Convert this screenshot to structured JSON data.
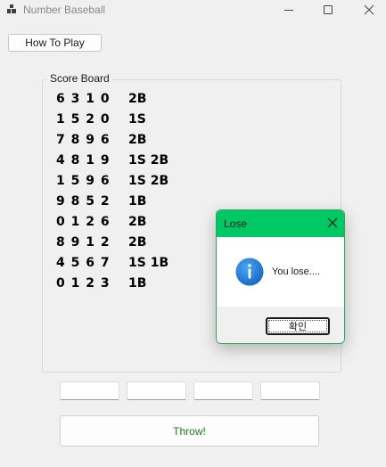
{
  "window": {
    "title": "Number Baseball",
    "icon": "app-icon",
    "controls": {
      "minimize_icon": "minimize-icon",
      "maximize_icon": "maximize-icon",
      "close_icon": "close-icon"
    }
  },
  "how_to_play_label": "How To Play",
  "scoreboard": {
    "title": "Score Board",
    "rows": [
      {
        "guess": "6 3 1 0",
        "result": "2B"
      },
      {
        "guess": "1 5 2 0",
        "result": "1S"
      },
      {
        "guess": "7 8 9 6",
        "result": "2B"
      },
      {
        "guess": "4 8 1 9",
        "result": "1S 2B"
      },
      {
        "guess": "1 5 9 6",
        "result": "1S 2B"
      },
      {
        "guess": "9 8 5 2",
        "result": "1B"
      },
      {
        "guess": "0 1 2 6",
        "result": "2B"
      },
      {
        "guess": "8 9 1 2",
        "result": "2B"
      },
      {
        "guess": "4 5 6 7",
        "result": "1S 1B"
      },
      {
        "guess": "0 1 2 3",
        "result": "1B"
      }
    ]
  },
  "inputs": [
    {
      "value": ""
    },
    {
      "value": ""
    },
    {
      "value": ""
    },
    {
      "value": ""
    }
  ],
  "throw_label": "Throw!",
  "dialog": {
    "title": "Lose",
    "message": "You lose....",
    "ok_label": "확인",
    "icon": "info-icon"
  },
  "colors": {
    "dialog_titlebar": "#00c864",
    "throw_text": "#1e7a1e",
    "info_icon": "#1e7fd8"
  }
}
